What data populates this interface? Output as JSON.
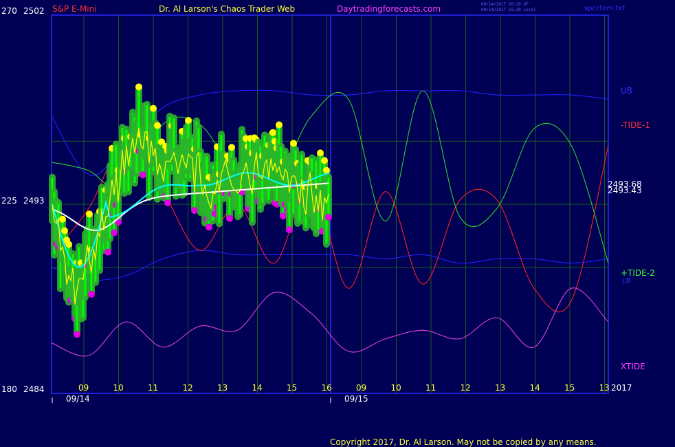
{
  "header": {
    "symbol": "S&P E-Mini",
    "title": "Dr. Al Larson's Chaos Trader Web",
    "site": "Daytradingforecasts.com",
    "timestamp_utc": "09/14/2017 20:20 UT",
    "timestamp_local": "09/14/2017 15:20 Local",
    "file": "spcctom.txt"
  },
  "footer": {
    "copyright": "Copyright 2017, Dr. Al Larson. May not be copied by any means."
  },
  "colors": {
    "background": "#000054",
    "frame": "#2a2aff",
    "grid": "#1c5c1c",
    "ub_lb": "#2020ff",
    "tide1": "#ff2020",
    "tide2": "#30d030",
    "xtide": "#e040e0",
    "yellow_ma": "#ffff00",
    "cyan_ma": "#00ffff",
    "white_ma": "#ffffff",
    "candle_halo": "#2cb02c",
    "candle_body": "#00ff00",
    "dot_high": "#ffff00",
    "dot_low": "#e000e0"
  },
  "chart_data": {
    "type": "line",
    "title": "S&P E-Mini",
    "y_left_scale": {
      "labels": [
        "270",
        "225",
        "180"
      ],
      "range": [
        180,
        270
      ]
    },
    "y_price_scale": {
      "labels": [
        "2502",
        "2493",
        "2484"
      ],
      "range": [
        2484,
        2502
      ]
    },
    "x_time_labels": [
      "09",
      "10",
      "11",
      "12",
      "13",
      "14",
      "15",
      "16",
      "09",
      "10",
      "11",
      "12",
      "13",
      "14",
      "15",
      "13"
    ],
    "x_year": "2017",
    "x_dates": [
      "09/14",
      "09/15"
    ],
    "price_labels": [
      "2493.68",
      "2493.43"
    ],
    "series": [
      {
        "name": "UB",
        "values": [
          246,
          232,
          239,
          248,
          251,
          252,
          252,
          251,
          251,
          252,
          252,
          252,
          251,
          251,
          251,
          250
        ]
      },
      {
        "name": "LB",
        "values": [
          210,
          207,
          208,
          212,
          214,
          213,
          213,
          213,
          213,
          212,
          213,
          211,
          212,
          212,
          211,
          212
        ]
      },
      {
        "name": "-TIDE-1",
        "values": [
          213,
          224,
          240,
          228,
          214,
          225,
          211,
          230,
          205,
          228,
          206,
          226,
          226,
          205,
          202,
          239
        ]
      },
      {
        "name": "+TIDE-2",
        "values": [
          235,
          233,
          228,
          244,
          244,
          232,
          230,
          246,
          250,
          221,
          252,
          222,
          224,
          243,
          239,
          211
        ]
      },
      {
        "name": "XTIDE",
        "values": [
          192,
          189,
          197,
          191,
          196,
          195,
          204,
          199,
          190,
          193,
          195,
          193,
          198,
          191,
          205,
          197
        ]
      }
    ]
  },
  "legend_labels": {
    "ub": "UB",
    "tide1": "-TIDE-1",
    "tide2": "+TIDE-2",
    "lb": "LB",
    "xtide": "XTIDE"
  }
}
